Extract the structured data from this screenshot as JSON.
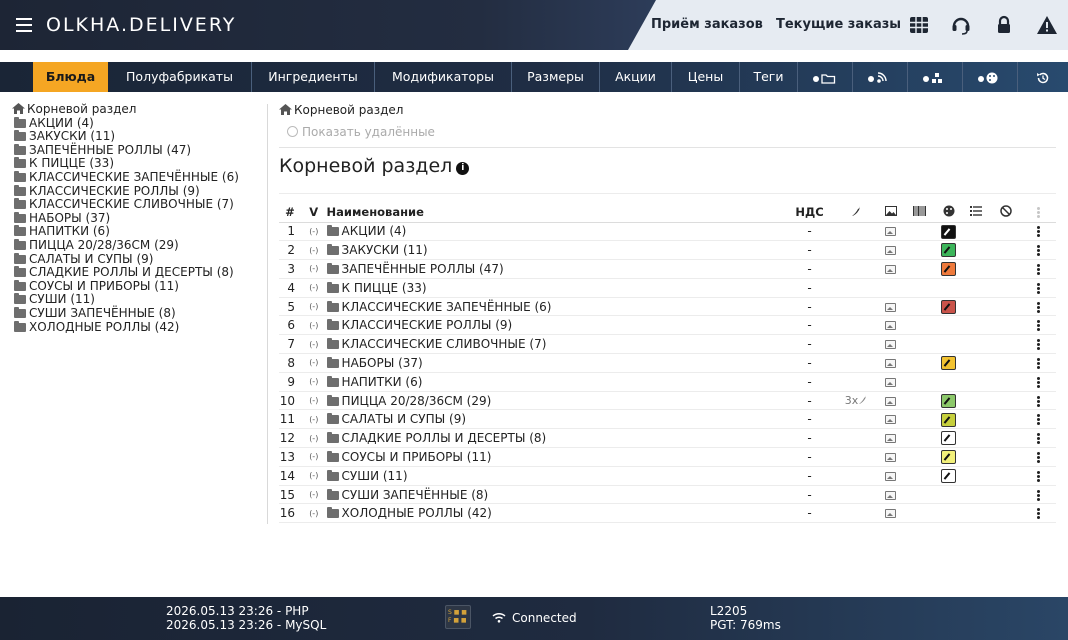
{
  "header": {
    "logo": "OLKHA.DELIVERY",
    "link_orders": "Приём заказов",
    "link_current": "Текущие заказы",
    "icons": [
      "grid-icon",
      "headset-icon",
      "lock-icon",
      "warning-icon"
    ]
  },
  "nav": {
    "tabs": [
      "Блюда",
      "Полуфабрикаты",
      "Ингредиенты",
      "Модификаторы",
      "Размеры",
      "Акции",
      "Цены",
      "Теги"
    ],
    "active": "Блюда",
    "icon_tabs": [
      "folder-add-icon",
      "rss-add-icon",
      "structure-add-icon",
      "palette-add-icon",
      "history-icon"
    ]
  },
  "tree": {
    "root": "Корневой раздел",
    "items": [
      "АКЦИИ (4)",
      "ЗАКУСКИ (11)",
      "ЗАПЕЧЁННЫЕ РОЛЛЫ (47)",
      "К ПИЦЦЕ (33)",
      "КЛАССИЧЕСКИЕ ЗАПЕЧЁННЫЕ (6)",
      "КЛАССИЧЕСКИЕ РОЛЛЫ (9)",
      "КЛАССИЧЕСКИЕ СЛИВОЧНЫЕ (7)",
      "НАБОРЫ (37)",
      "НАПИТКИ (6)",
      "ПИЦЦА 20/28/36СМ (29)",
      "САЛАТЫ И СУПЫ (9)",
      "СЛАДКИЕ РОЛЛЫ И ДЕСЕРТЫ (8)",
      "СОУСЫ И ПРИБОРЫ (11)",
      "СУШИ (11)",
      "СУШИ ЗАПЕЧЁННЫЕ (8)",
      "ХОЛОДНЫЕ РОЛЛЫ (42)"
    ]
  },
  "main": {
    "breadcrumb": "Корневой раздел",
    "show_deleted": "Показать удалённые",
    "title": "Корневой раздел",
    "columns": {
      "num": "#",
      "v": "V",
      "name": "Наименование",
      "vat": "НДС"
    },
    "rows": [
      {
        "num": "1",
        "v": "(-)",
        "name": "АКЦИИ (4)",
        "vat": "-",
        "spicy": "",
        "img": true,
        "color": "#111111"
      },
      {
        "num": "2",
        "v": "(-)",
        "name": "ЗАКУСКИ (11)",
        "vat": "-",
        "spicy": "",
        "img": true,
        "color": "#3cb55a"
      },
      {
        "num": "3",
        "v": "(-)",
        "name": "ЗАПЕЧЁННЫЕ РОЛЛЫ (47)",
        "vat": "-",
        "spicy": "",
        "img": true,
        "color": "#ee7a3c"
      },
      {
        "num": "4",
        "v": "(-)",
        "name": "К ПИЦЦЕ (33)",
        "vat": "-",
        "spicy": "",
        "img": false,
        "color": ""
      },
      {
        "num": "5",
        "v": "(-)",
        "name": "КЛАССИЧЕСКИЕ ЗАПЕЧЁННЫЕ (6)",
        "vat": "-",
        "spicy": "",
        "img": true,
        "color": "#c9534a"
      },
      {
        "num": "6",
        "v": "(-)",
        "name": "КЛАССИЧЕСКИЕ РОЛЛЫ (9)",
        "vat": "-",
        "spicy": "",
        "img": true,
        "color": ""
      },
      {
        "num": "7",
        "v": "(-)",
        "name": "КЛАССИЧЕСКИЕ СЛИВОЧНЫЕ (7)",
        "vat": "-",
        "spicy": "",
        "img": true,
        "color": ""
      },
      {
        "num": "8",
        "v": "(-)",
        "name": "НАБОРЫ (37)",
        "vat": "-",
        "spicy": "",
        "img": true,
        "color": "#f2c230"
      },
      {
        "num": "9",
        "v": "(-)",
        "name": "НАПИТКИ (6)",
        "vat": "-",
        "spicy": "",
        "img": true,
        "color": ""
      },
      {
        "num": "10",
        "v": "(-)",
        "name": "ПИЦЦА 20/28/36СМ (29)",
        "vat": "-",
        "spicy": "3x",
        "img": true,
        "color": "#8cc86a"
      },
      {
        "num": "11",
        "v": "(-)",
        "name": "САЛАТЫ И СУПЫ (9)",
        "vat": "-",
        "spicy": "",
        "img": true,
        "color": "#c6cf3c"
      },
      {
        "num": "12",
        "v": "(-)",
        "name": "СЛАДКИЕ РОЛЛЫ И ДЕСЕРТЫ (8)",
        "vat": "-",
        "spicy": "",
        "img": true,
        "color": "#ffffff"
      },
      {
        "num": "13",
        "v": "(-)",
        "name": "СОУСЫ И ПРИБОРЫ (11)",
        "vat": "-",
        "spicy": "",
        "img": true,
        "color": "#f2f07a"
      },
      {
        "num": "14",
        "v": "(-)",
        "name": "СУШИ (11)",
        "vat": "-",
        "spicy": "",
        "img": true,
        "color": "#ffffff"
      },
      {
        "num": "15",
        "v": "(-)",
        "name": "СУШИ ЗАПЕЧЁННЫЕ (8)",
        "vat": "-",
        "spicy": "",
        "img": true,
        "color": ""
      },
      {
        "num": "16",
        "v": "(-)",
        "name": "ХОЛОДНЫЕ РОЛЛЫ (42)",
        "vat": "-",
        "spicy": "",
        "img": true,
        "color": ""
      }
    ]
  },
  "footer": {
    "php_time": "2026.05.13 23:26 - PHP",
    "mysql_time": "2026.05.13 23:26 - MySQL",
    "status": "Connected",
    "load": "L2205",
    "pgt": "PGT: 769ms"
  }
}
